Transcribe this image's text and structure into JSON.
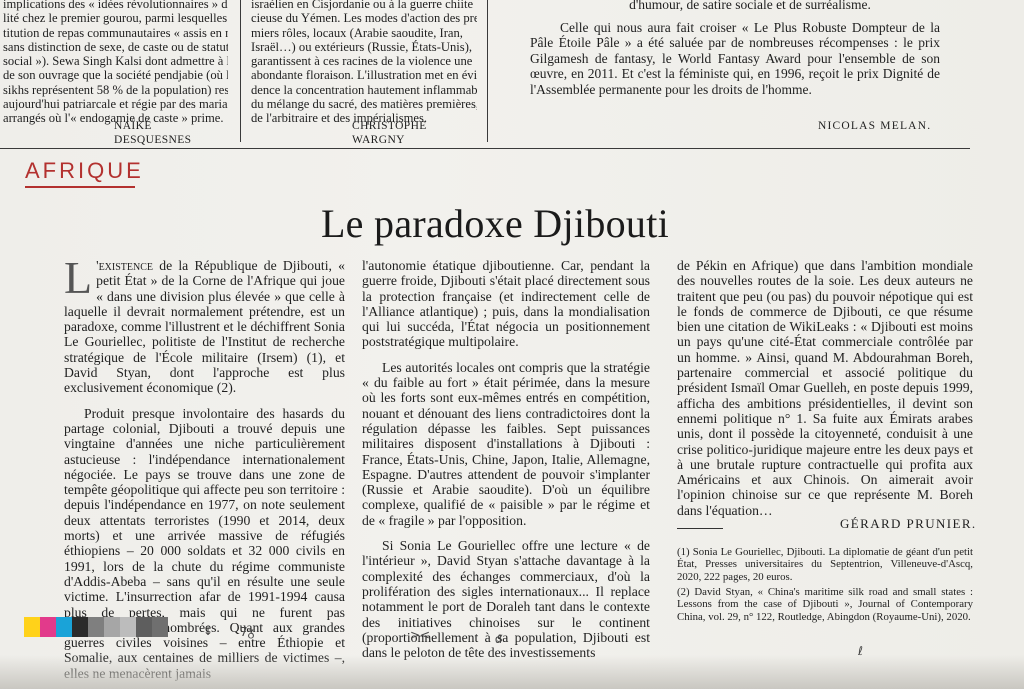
{
  "top": {
    "col1": {
      "text_html_lines": [
        "implications des « idées révolutionnaires » d'éga-",
        "lité chez le premier gourou, parmi lesquelles l'ins-",
        "titution de repas communautaires « assis en rangs,",
        "sans distinction de sexe, de caste ou de statut",
        "social »). Sewa Singh Kalsi dont admettre à la fin",
        "de son ouvrage que la société pendjabie (où les",
        "sikhs représentent 58 % de la population) reste",
        "aujourd'hui patriarcale et régie par des mariages",
        "arrangés où l'« endogamie de caste » prime."
      ],
      "signature": "Naïké Desquesnes"
    },
    "col2": {
      "text_lines": [
        "israélien en Cisjordanie ou à la guerre chiite",
        "cieuse du Yémen. Les modes d'action des pre-",
        "miers rôles, locaux (Arabie saoudite, Iran,",
        "Israël…) ou extérieurs (Russie, États-Unis),",
        "garantissent à ces racines de la violence une",
        "abondante floraison. L'illustration met en évi-",
        "dence la concentration hautement inflammable",
        "du mélange du sacré, des matières premières,",
        "de l'arbitraire et des impérialismes."
      ],
      "signature": "Christophe Wargny"
    },
    "col3": {
      "text": "Celle qui nous aura fait croiser « Le Plus Robuste Dompteur de la Pâle Étoile Pâle » a été saluée par de nombreuses récompenses : le prix Gilgamesh de fantasy, le World Fantasy Award pour l'ensemble de son œuvre, en 2011. Et c'est la féministe qui, en 1996, reçoit le prix Dignité de l'Assemblée permanente pour les droits de l'homme.",
      "top_fragment": "d'humour, de satire sociale et de surréalisme.",
      "signature": "Nicolas Melan."
    }
  },
  "section": "Afrique",
  "headline": "Le paradoxe Djibouti",
  "article": {
    "col1": {
      "dropcap": "L",
      "p1_lead": "'existence",
      "p1_rest": " de la République de Djibouti, « petit État » de la Corne de l'Afrique qui joue « dans une division plus élevée » que celle à laquelle il devrait normalement prétendre, est un paradoxe, comme l'illustrent et le déchiffrent Sonia Le Gouriellec, politiste de l'Institut de recherche stratégique de l'École militaire (Irsem) (1), et David Styan, dont l'approche est plus exclusivement économique (2).",
      "p2": "Produit presque involontaire des hasards du partage colonial, Djibouti a trouvé depuis une vingtaine d'années une niche particulièrement astucieuse : l'indépendance internationalement négociée. Le pays se trouve dans une zone de tempête géopolitique qui affecte peu son territoire : depuis l'indépendance en 1977, on note seulement deux attentats terroristes (1990 et 2014, deux morts) et une arrivée massive de réfugiés éthiopiens – 20 000 soldats et 32 000 civils en 1991, lors de la chute du régime communiste d'Addis-Abeba – sans qu'il en résulte une seule victime. L'insurrection afar de 1991-1994 causa plus de pertes, mais qui ne furent pas officiellement dénombrées. Quant aux grandes guerres civiles voisines – entre Éthiopie et Somalie, aux centaines de milliers de victimes –, elles ne menacèrent jamais"
    },
    "col2": {
      "p1": "l'autonomie étatique djiboutienne. Car, pendant la guerre froide, Djibouti s'était placé directement sous la protection française (et indirectement celle de l'Alliance atlantique) ; puis, dans la mondialisation qui lui succéda, l'État négocia un positionnement poststratégique multipolaire.",
      "p2": "Les autorités locales ont compris que la stratégie « du faible au fort » était périmée, dans la mesure où les forts sont eux-mêmes entrés en compétition, nouant et dénouant des liens contradictoires dont la régulation dépasse les faibles. Sept puissances militaires disposent d'installations à Djibouti : France, États-Unis, Chine, Japon, Italie, Allemagne, Espagne. D'autres attendent de pouvoir s'implanter (Russie et Arabie saoudite). D'où un équilibre complexe, qualifié de « paisible » par le régime et de « fragile » par l'opposition.",
      "p3": "Si Sonia Le Gouriellec offre une lecture « de l'intérieur », David Styan s'attache davantage à la complexité des échanges commerciaux, d'où la prolifération des sigles internationaux... Il replace notamment le port de Doraleh tant dans le contexte des initiatives chinoises sur le continent (proportionnellement à sa population, Djibouti est dans le peloton de tête des investissements"
    },
    "col3": {
      "p1": "de Pékin en Afrique) que dans l'ambition mondiale des nouvelles routes de la soie. Les deux auteurs ne traitent que peu (ou pas) du pouvoir népotique qui est le fonds de commerce de Djibouti, ce que résume bien une citation de WikiLeaks : « Djibouti est moins un pays qu'une cité-État commerciale contrôlée par un homme. » Ainsi, quand M. Abdourahman Boreh, partenaire commercial et associé politique du président Ismaïl Omar Guelleh, en poste depuis 1999, afficha des ambitions présidentielles, il devint son ennemi politique n° 1. Sa fuite aux Émirats arabes unis, dont il possède la citoyenneté, conduisit à une crise politico-juridique majeure entre les deux pays et à une brutale rupture contractuelle qui profita aux Américains et aux Chinois. On aimerait avoir l'opinion chinoise sur ce que représente M. Boreh dans l'équation…",
      "signature": "Gérard Prunier."
    },
    "footnotes": [
      "(1) Sonia Le Gouriellec, Djibouti. La diplomatie de géant d'un petit État, Presses universitaires du Septentrion, Villeneuve-d'Ascq, 2020, 222 pages, 20 euros.",
      "(2) David Styan, « China's maritime silk road and small states : Lessons from the case of Djibouti », Journal of Contemporary China, vol. 29, n° 122, Routledge, Abingdon (Royaume-Uni), 2020."
    ]
  },
  "print_marks": {
    "colors": [
      "#ffd21a",
      "#e23a8b",
      "#1aa3d8",
      "#2b2b2b",
      "#7f7f7f",
      "#a6a6a6",
      "#bcbcbc",
      "#5e5e5e",
      "#6f6f6f"
    ],
    "glyphs": [
      "↓",
      "7ᵹ",
      "><",
      "ᵭ",
      "ℓ"
    ]
  },
  "colors": {
    "section_red": "#b3312f",
    "paper": "#efeeea",
    "ink": "#1f1f1f"
  }
}
